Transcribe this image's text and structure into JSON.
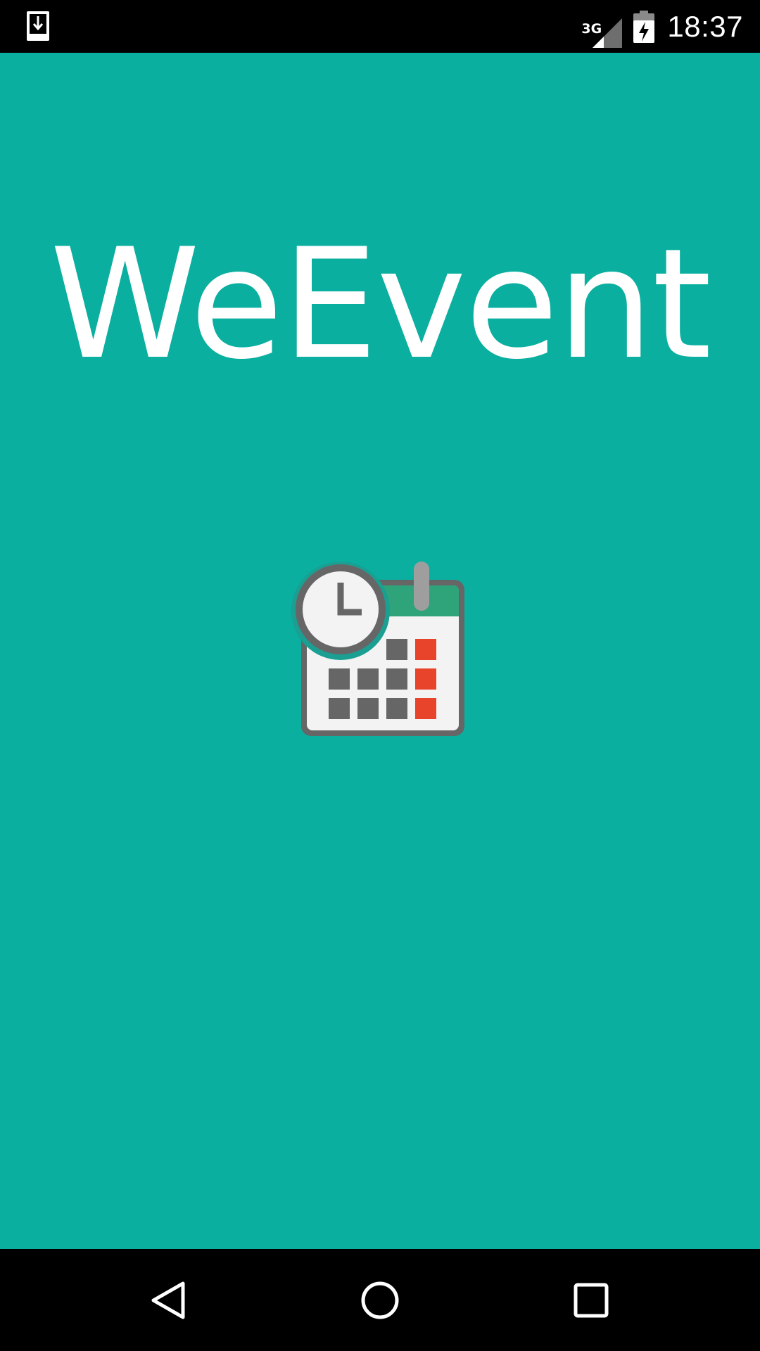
{
  "status_bar": {
    "left_icon": "download-notification-icon",
    "network_type": "3G",
    "signal_icon": "cell-signal-icon",
    "battery_icon": "battery-charging-icon",
    "time": "18:37"
  },
  "main": {
    "app_title": "WeEvent",
    "logo_icon": "calendar-clock-icon"
  },
  "nav_bar": {
    "back_icon": "back-triangle-icon",
    "home_icon": "home-circle-icon",
    "recents_icon": "recents-square-icon"
  },
  "colors": {
    "background": "#0aaf9f",
    "bars": "#000000",
    "title": "#ffffff",
    "calendar_header": "#2fa37a",
    "calendar_red": "#e8432b",
    "calendar_grey": "#666666"
  }
}
